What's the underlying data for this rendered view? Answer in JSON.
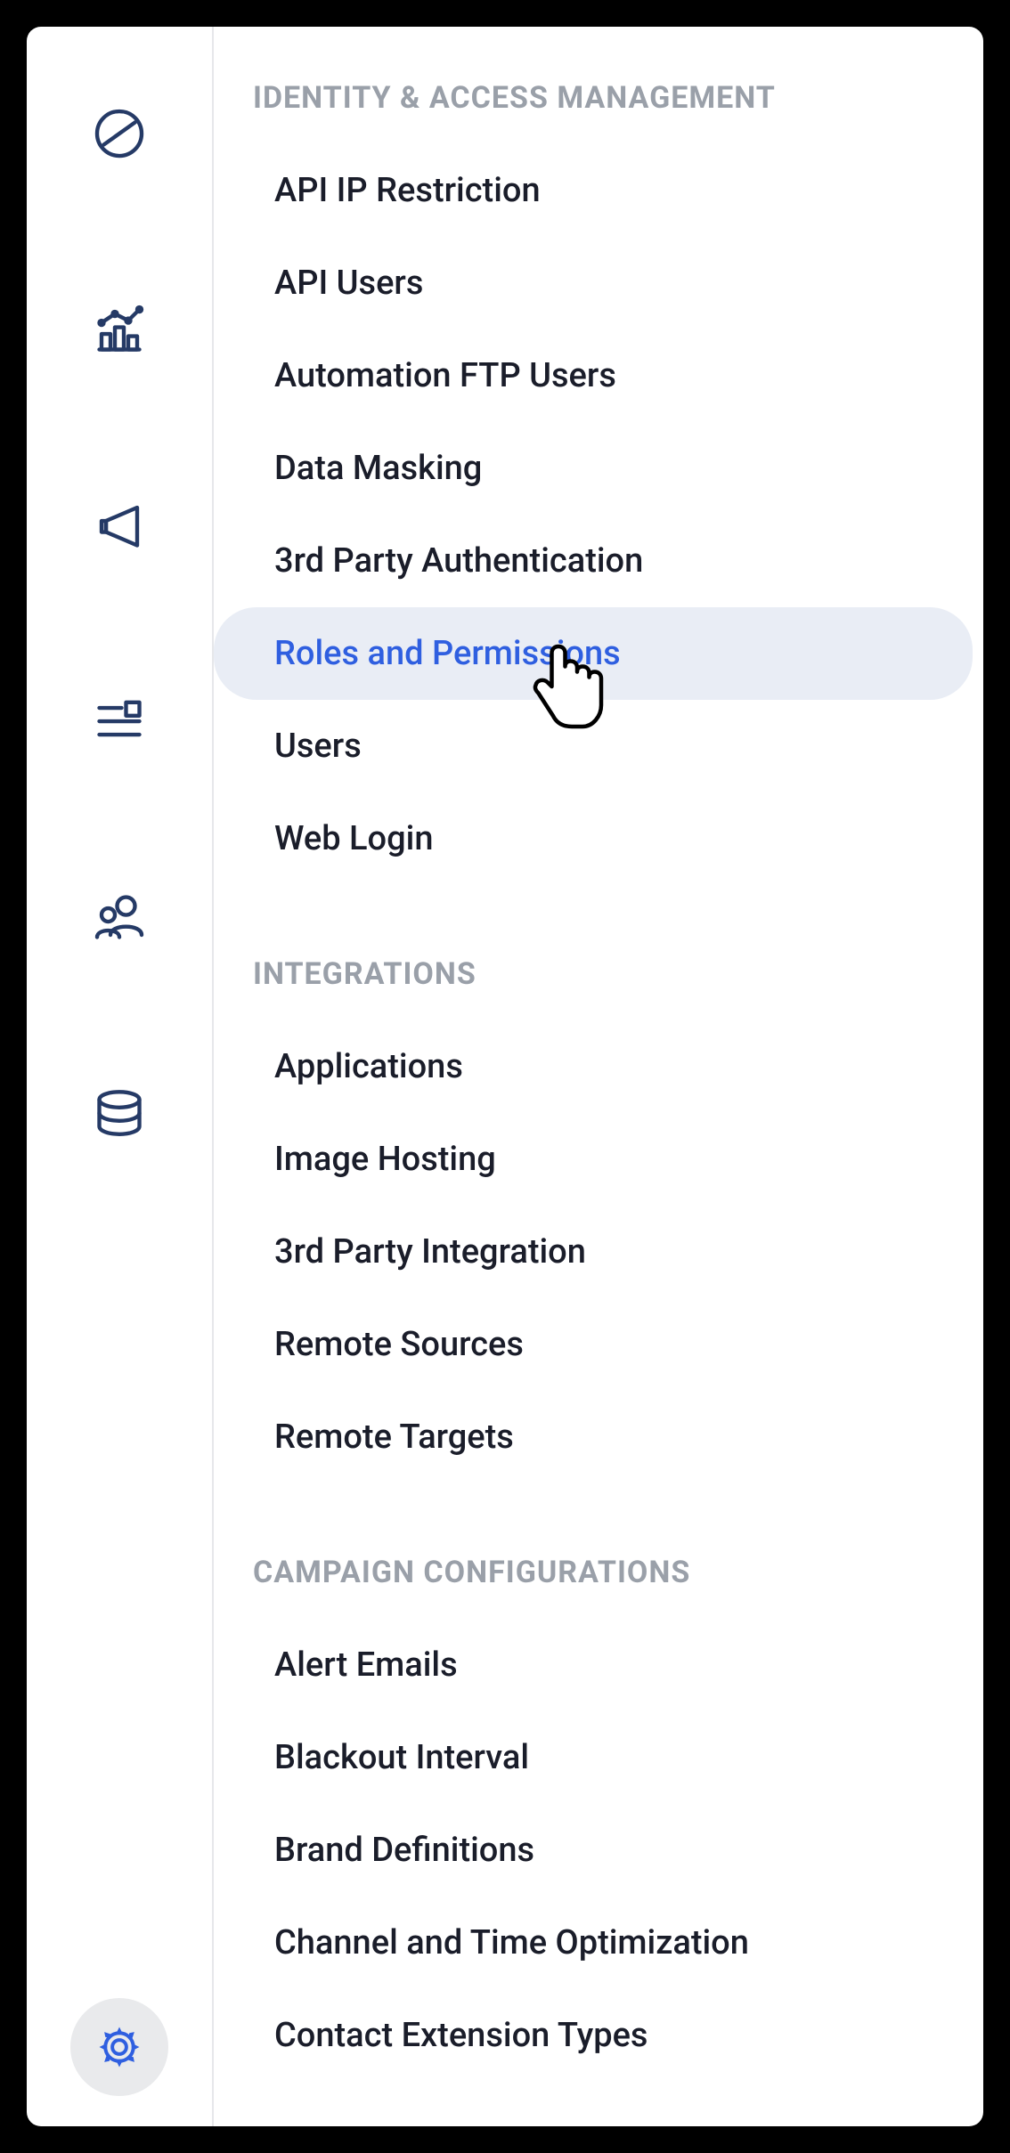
{
  "rail": {
    "icons": [
      {
        "name": "pie-chart-icon"
      },
      {
        "name": "analytics-icon"
      },
      {
        "name": "megaphone-icon"
      },
      {
        "name": "list-layout-icon"
      },
      {
        "name": "people-icon"
      },
      {
        "name": "database-icon"
      }
    ],
    "settings_icon": "gear-icon"
  },
  "sections": [
    {
      "title": "IDENTITY & ACCESS MANAGEMENT",
      "items": [
        {
          "label": "API IP Restriction",
          "active": false
        },
        {
          "label": "API Users",
          "active": false
        },
        {
          "label": "Automation FTP Users",
          "active": false
        },
        {
          "label": "Data Masking",
          "active": false
        },
        {
          "label": "3rd Party Authentication",
          "active": false
        },
        {
          "label": "Roles and Permissions",
          "active": true
        },
        {
          "label": "Users",
          "active": false
        },
        {
          "label": "Web Login",
          "active": false
        }
      ]
    },
    {
      "title": "INTEGRATIONS",
      "items": [
        {
          "label": "Applications",
          "active": false
        },
        {
          "label": "Image Hosting",
          "active": false
        },
        {
          "label": "3rd Party Integration",
          "active": false
        },
        {
          "label": "Remote Sources",
          "active": false
        },
        {
          "label": "Remote Targets",
          "active": false
        }
      ]
    },
    {
      "title": "CAMPAIGN CONFIGURATIONS",
      "items": [
        {
          "label": "Alert Emails",
          "active": false
        },
        {
          "label": "Blackout Interval",
          "active": false
        },
        {
          "label": "Brand Definitions",
          "active": false
        },
        {
          "label": "Channel and Time Optimization",
          "active": false
        },
        {
          "label": "Contact Extension Types",
          "active": false
        }
      ]
    }
  ]
}
